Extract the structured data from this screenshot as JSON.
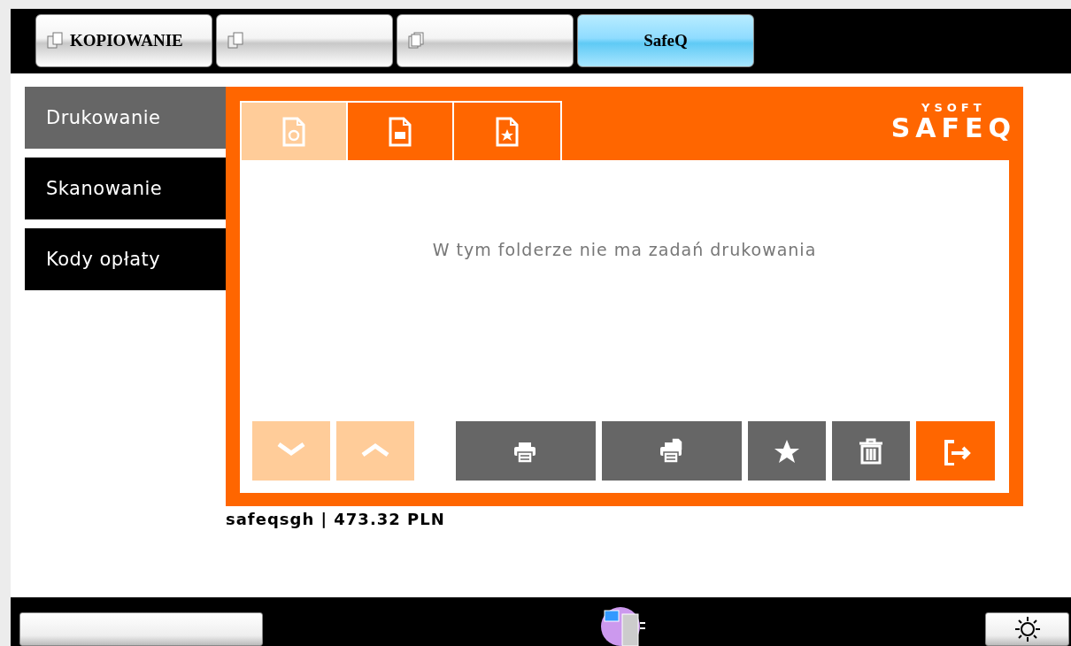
{
  "mode_tabs": [
    {
      "label": "KOPIOWANIE",
      "kind": "copy",
      "selected": false
    },
    {
      "kind": "documents",
      "selected": false
    },
    {
      "kind": "stack",
      "selected": false
    },
    {
      "label": "SafeQ",
      "kind": "text",
      "selected": true
    }
  ],
  "sidebar": {
    "items": [
      {
        "label": "Drukowanie",
        "selected": true
      },
      {
        "label": "Skanowanie",
        "selected": false
      },
      {
        "label": "Kody opłaty",
        "selected": false
      }
    ]
  },
  "panel": {
    "tabs": [
      {
        "kind": "pending",
        "selected": true
      },
      {
        "kind": "printed",
        "selected": false
      },
      {
        "kind": "favorite",
        "selected": false
      }
    ],
    "logo": {
      "top": "YSOFT",
      "main": "SAFEQ"
    },
    "message": "W tym folderze nie ma zadań drukowania",
    "actions": [
      {
        "kind": "down",
        "disabled": true
      },
      {
        "kind": "up",
        "disabled": true
      },
      {
        "kind": "print",
        "disabled": false
      },
      {
        "kind": "print-copy",
        "disabled": false
      },
      {
        "kind": "star",
        "disabled": false
      },
      {
        "kind": "delete",
        "disabled": false
      },
      {
        "kind": "logout",
        "disabled": false
      }
    ]
  },
  "footer": "safeqsgh | 473.32 PLN"
}
